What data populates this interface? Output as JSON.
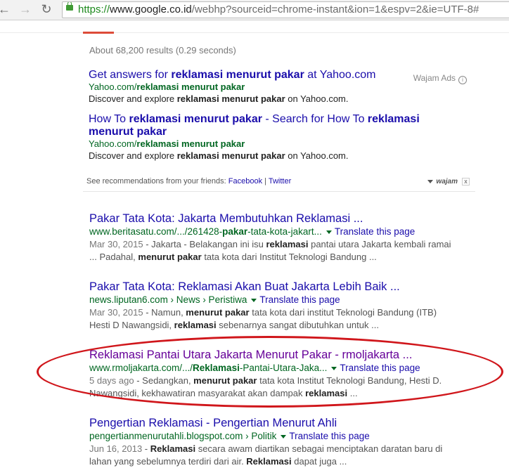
{
  "browser": {
    "url_scheme": "https://",
    "url_host": "www.google.co.id",
    "url_path": "/webhp?sourceid=chrome-instant&ion=1&espv=2&ie=UTF-8#"
  },
  "stats": "About 68,200 results (0.29 seconds)",
  "ads": {
    "label": "Wajam Ads",
    "items": [
      {
        "title_pre": "Get answers for ",
        "title_bold": "reklamasi menurut pakar",
        "title_post": " at Yahoo.com",
        "url_pre": "Yahoo.com/",
        "url_bold": "reklamasi menurut pakar",
        "desc_pre": "Discover and explore ",
        "desc_bold": "reklamasi menurut pakar",
        "desc_post": " on Yahoo.com."
      },
      {
        "title_pre": "How To ",
        "title_bold": "reklamasi menurut pakar",
        "title_mid": " - Search for How To ",
        "title_bold2": "reklamasi menurut pakar",
        "url_pre": "Yahoo.com/",
        "url_bold": "reklamasi menurut pakar",
        "desc_pre": "Discover and explore ",
        "desc_bold": "reklamasi menurut pakar",
        "desc_post": " on Yahoo.com."
      }
    ],
    "recs_text": "See recommendations from your friends: ",
    "recs_facebook": "Facebook",
    "recs_sep": " | ",
    "recs_twitter": "Twitter",
    "brand": "wajam",
    "close": "x"
  },
  "results": [
    {
      "title": "Pakar Tata Kota: Jakarta Membutuhkan Reklamasi ...",
      "url_pre": "www.beritasatu.com/.../261428-",
      "url_bold": "pakar",
      "url_post": "-tata-kota-jakart...",
      "translate": "Translate this page",
      "date": "Mar 30, 2015",
      "s1": " - Jakarta - Belakangan ini isu ",
      "b1": "reklamasi",
      "s2": " pantai utara Jakarta kembali ramai ... Padahal, ",
      "b2": "menurut pakar",
      "s3": " tata kota dari Institut Teknologi Bandung  ..."
    },
    {
      "title": "Pakar Tata Kota: Reklamasi Akan Buat Jakarta Lebih Baik ...",
      "url_pre": "news.liputan6.com › News › Peristiwa",
      "url_bold": "",
      "url_post": "",
      "translate": "Translate this page",
      "date": "Mar 30, 2015",
      "s1": " - Namun, ",
      "b1": "menurut pakar",
      "s2": " tata kota dari institut Teknologi Bandung (ITB) Hesti D Nawangsidi, ",
      "b2": "reklamasi",
      "s3": " sebenarnya sangat dibutuhkan untuk  ..."
    },
    {
      "title": "Reklamasi Pantai Utara Jakarta Menurut Pakar - rmoljakarta ...",
      "url_pre": "www.rmoljakarta.com/.../",
      "url_bold": "Reklamasi",
      "url_post": "-Pantai-Utara-Jaka...",
      "translate": "Translate this page",
      "date": "5 days ago",
      "s1": " - Sedangkan, ",
      "b1": "menurut pakar",
      "s2": " tata kota Institut Teknologi Bandung, Hesti D. Nawangsidi, kekhawatiran masyarakat akan dampak ",
      "b2": "reklamasi",
      "s3": " ..."
    },
    {
      "title": "Pengertian Reklamasi - Pengertian Menurut Ahli",
      "url_pre": "pengertianmenurutahli.blogspot.com › Politik",
      "url_bold": "",
      "url_post": "",
      "translate": "Translate this page",
      "date": "Jun 16, 2013",
      "s1": " - ",
      "b1": "Reklamasi",
      "s2": " secara awam diartikan sebagai menciptakan daratan baru di lahan yang sebelumnya terdiri dari air. ",
      "b2": "Reklamasi",
      "s3": " dapat juga ..."
    }
  ]
}
